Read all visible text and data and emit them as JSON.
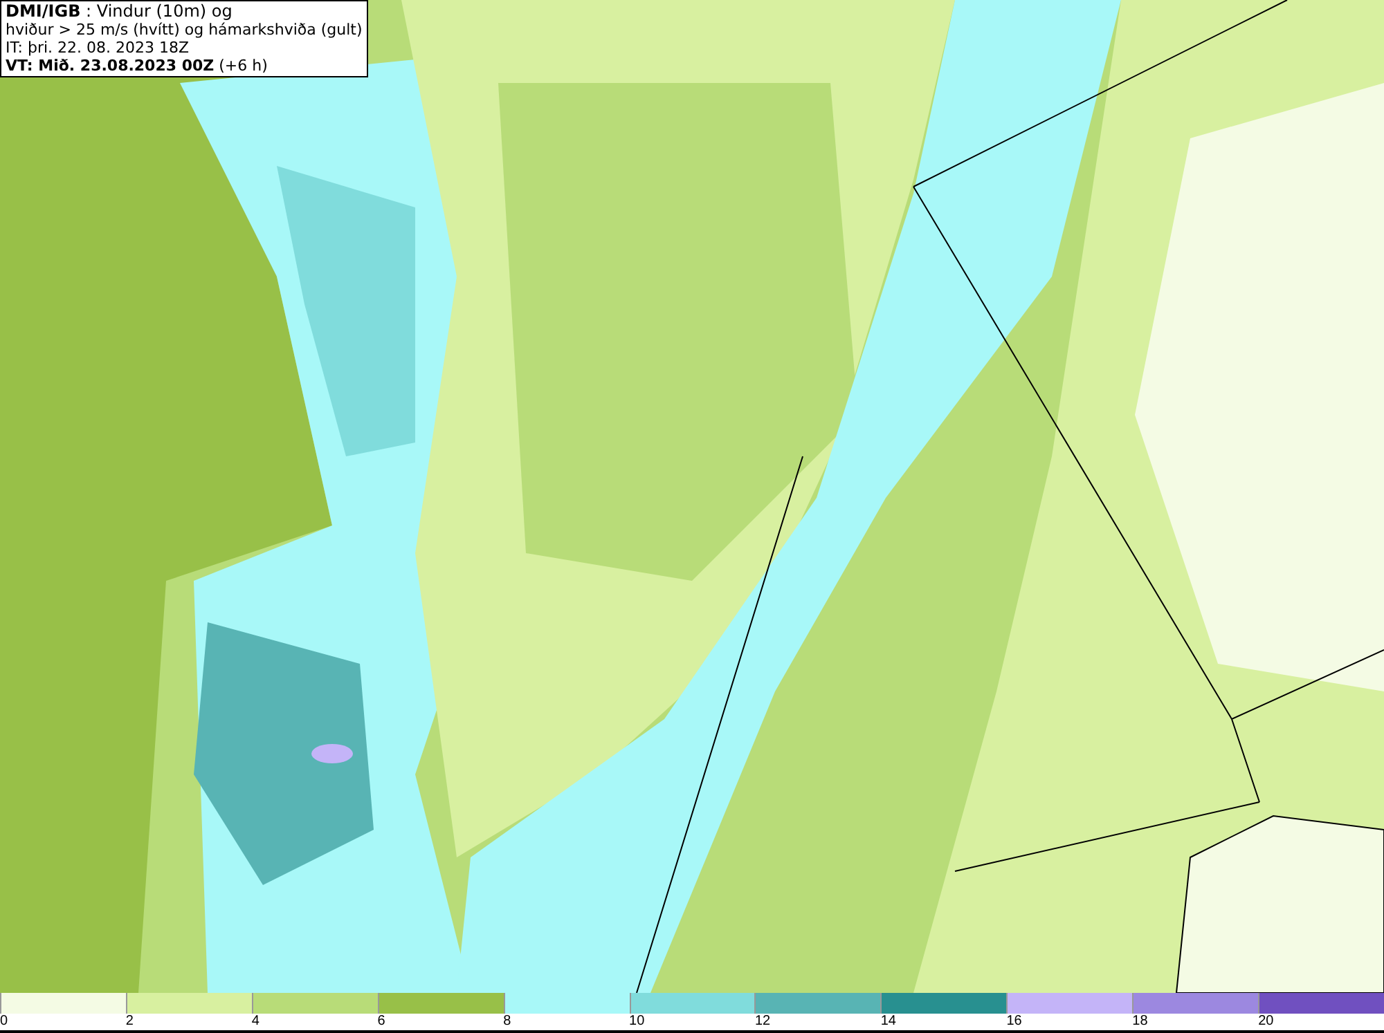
{
  "title_box": {
    "lines": [
      "**DMI/IGB** : Vindur (10m) og",
      "hviður > 25 m/s (hvítt) og hámarkshviða (gult)",
      "IT: þri. 22. 08. 2023 18Z",
      "**VT: Mið. 23.08.2023 00Z** (+6 h)"
    ]
  },
  "colorbar": {
    "bins": [
      {
        "color": "#f4fbe4",
        "tick": "0"
      },
      {
        "color": "#d8f0a0",
        "tick": "2"
      },
      {
        "color": "#b8dc78",
        "tick": "4"
      },
      {
        "color": "#98c048",
        "tick": "6"
      },
      {
        "color": "#a8f8f8",
        "tick": "8"
      },
      {
        "color": "#80dcdc",
        "tick": "10"
      },
      {
        "color": "#58b4b4",
        "tick": "12"
      },
      {
        "color": "#289090",
        "tick": "14"
      },
      {
        "color": "#c4b4f8",
        "tick": "16"
      },
      {
        "color": "#9c88e0",
        "tick": "18"
      },
      {
        "color": "#7050c0",
        "tick": "20"
      }
    ]
  }
}
